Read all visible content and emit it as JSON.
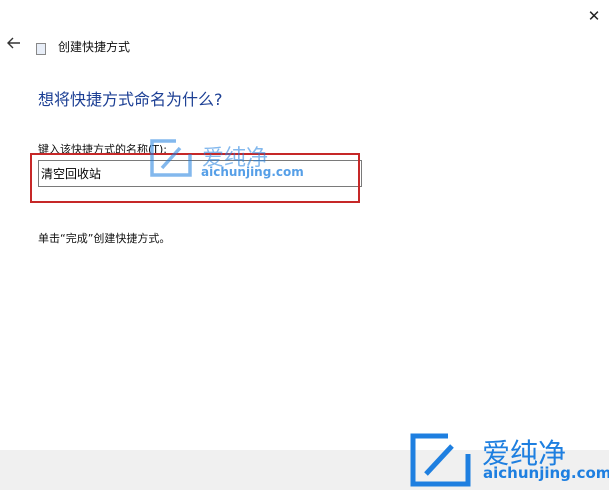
{
  "titlebar": {
    "close_glyph": "✕"
  },
  "wizard": {
    "title": "创建快捷方式",
    "heading": "想将快捷方式命名为什么?",
    "field_label": "键入该快捷方式的名称(T):",
    "name_value": "清空回收站",
    "hint": "单击“完成”创建快捷方式。"
  },
  "watermark": {
    "cn": "爱纯净",
    "url": "aichunjing.com"
  },
  "icons": {
    "back": "arrow-left-icon",
    "wizard": "shortcut-wizard-icon",
    "close": "close-icon",
    "logo": "aichunjing-logo-icon"
  },
  "colors": {
    "heading": "#1c3f94",
    "highlight": "#c62828",
    "watermark": "#1e7fe0",
    "footer": "#f0f0f0"
  }
}
